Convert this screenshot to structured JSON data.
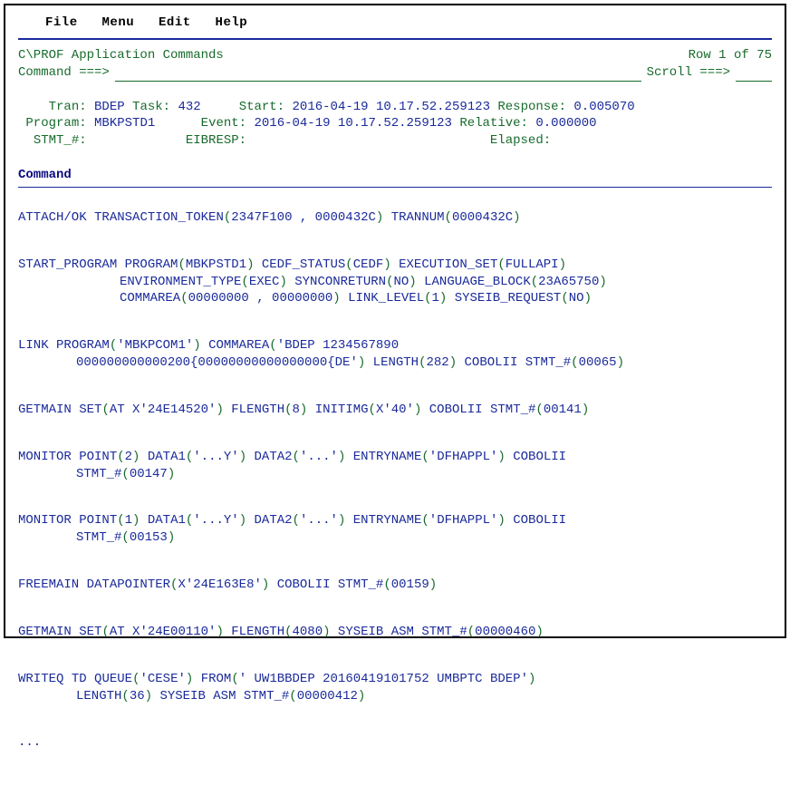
{
  "menu": {
    "file": "File",
    "menu": "Menu",
    "edit": "Edit",
    "help": "Help"
  },
  "header": {
    "title": "C\\PROF Application Commands",
    "rowinfo": "Row 1 of 75",
    "cmd_label": "Command ===>",
    "scroll_label": "Scroll ===>",
    "cmd_value": "",
    "scroll_value": ""
  },
  "info": {
    "tran_lbl": "Tran:",
    "tran": "BDEP",
    "task_lbl": "Task:",
    "task": "432",
    "start_lbl": "Start:",
    "start": "2016-04-19 10.17.52.259123",
    "response_lbl": "Response:",
    "response": "0.005070",
    "program_lbl": "Program:",
    "program": "MBKPSTD1",
    "event_lbl": "Event:",
    "event": "2016-04-19 10.17.52.259123",
    "relative_lbl": "Relative:",
    "relative": "0.000000",
    "stmt_lbl": "STMT_#:",
    "eibresp_lbl": "EIBRESP:",
    "elapsed_lbl": "Elapsed:"
  },
  "section_label": "Command",
  "cmds": {
    "attach": {
      "kw": "ATTACH/OK",
      "tt_lbl": "TRANSACTION_TOKEN",
      "tt_v": "2347F100 , 0000432C",
      "tn_lbl": "TRANNUM",
      "tn_v": "0000432C"
    },
    "startprog": {
      "kw": "START_PROGRAM",
      "prog_lbl": "PROGRAM",
      "prog_v": "MBKPSTD1",
      "cedf_lbl": "CEDF_STATUS",
      "cedf_v": "CEDF",
      "exe_lbl": "EXECUTION_SET",
      "exe_v": "FULLAPI",
      "env_lbl": "ENVIRONMENT_TYPE",
      "env_v": "EXEC",
      "sync_lbl": "SYNCONRETURN",
      "sync_v": "NO",
      "lang_lbl": "LANGUAGE_BLOCK",
      "lang_v": "23A65750",
      "comm_lbl": "COMMAREA",
      "comm_v": "00000000 , 00000000",
      "ll_lbl": "LINK_LEVEL",
      "ll_v": "1",
      "syr_lbl": "SYSEIB_REQUEST",
      "syr_v": "NO"
    },
    "link": {
      "kw": "LINK",
      "prog_lbl": "PROGRAM",
      "prog_v": "'MBKPCOM1'",
      "comm_lbl": "COMMAREA",
      "comm_v": "'BDEP 1234567890",
      "comm_v2": "000000000000200{00000000000000000{DE'",
      "len_lbl": "LENGTH",
      "len_v": "282",
      "lang": "COBOLII",
      "stmt_lbl": "STMT_#",
      "stmt_v": "00065"
    },
    "getmain1": {
      "kw": "GETMAIN",
      "set_lbl": "SET",
      "set_v": "AT X'24E14520'",
      "fl_lbl": "FLENGTH",
      "fl_v": "8",
      "ini_lbl": "INITIMG",
      "ini_v": "X'40'",
      "lang": "COBOLII",
      "stmt_lbl": "STMT_#",
      "stmt_v": "00141"
    },
    "mon1": {
      "kw": "MONITOR",
      "pt_lbl": "POINT",
      "pt_v": "2",
      "d1_lbl": "DATA1",
      "d1_v": "'...Y'",
      "d2_lbl": "DATA2",
      "d2_v": "'...'",
      "en_lbl": "ENTRYNAME",
      "en_v": "'DFHAPPL'",
      "lang": "COBOLII",
      "stmt_lbl": "STMT_#",
      "stmt_v": "00147"
    },
    "mon2": {
      "kw": "MONITOR",
      "pt_lbl": "POINT",
      "pt_v": "1",
      "d1_lbl": "DATA1",
      "d1_v": "'...Y'",
      "d2_lbl": "DATA2",
      "d2_v": "'...'",
      "en_lbl": "ENTRYNAME",
      "en_v": "'DFHAPPL'",
      "lang": "COBOLII",
      "stmt_lbl": "STMT_#",
      "stmt_v": "00153"
    },
    "freemain": {
      "kw": "FREEMAIN",
      "dp_lbl": "DATAPOINTER",
      "dp_v": "X'24E163E8'",
      "lang": "COBOLII",
      "stmt_lbl": "STMT_#",
      "stmt_v": "00159"
    },
    "getmain2": {
      "kw": "GETMAIN",
      "set_lbl": "SET",
      "set_v": "AT X'24E00110'",
      "fl_lbl": "FLENGTH",
      "fl_v": "4080",
      "lang": "SYSEIB ASM",
      "stmt_lbl": "STMT_#",
      "stmt_v": "00000460"
    },
    "writeq": {
      "kw": "WRITEQ",
      "td": "TD",
      "q_lbl": "QUEUE",
      "q_v": "'CESE'",
      "from_lbl": "FROM",
      "from_v": "' UW1BBDEP 20160419101752 UMBPTC BDEP'",
      "len_lbl": "LENGTH",
      "len_v": "36",
      "lang": "SYSEIB ASM",
      "stmt_lbl": "STMT_#",
      "stmt_v": "00000412"
    }
  },
  "ellipsis": "..."
}
